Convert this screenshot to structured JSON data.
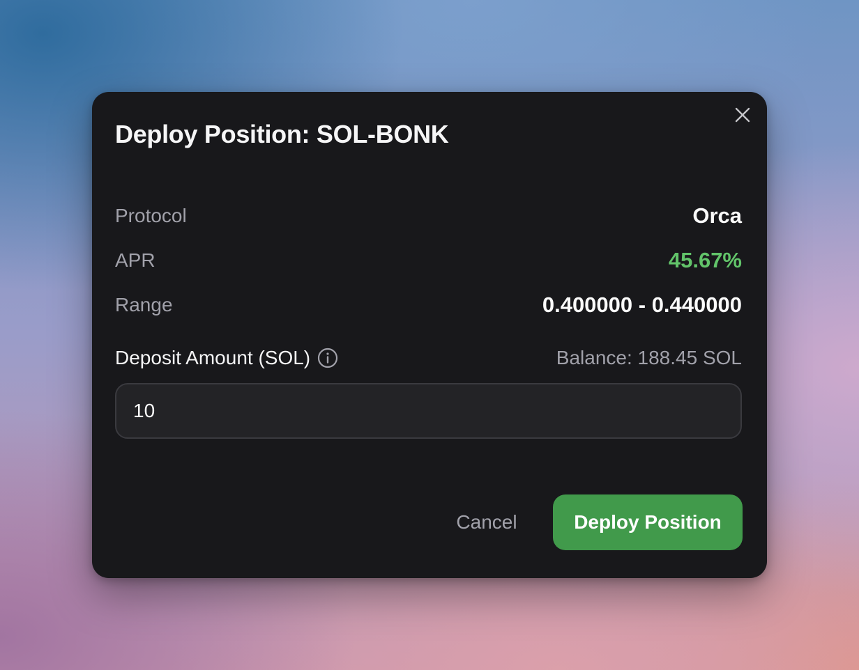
{
  "modal": {
    "title": "Deploy Position: SOL-BONK",
    "close_icon": "close-icon"
  },
  "details": {
    "protocol": {
      "label": "Protocol",
      "value": "Orca"
    },
    "apr": {
      "label": "APR",
      "value": "45.67%",
      "color": "#62c46a"
    },
    "range": {
      "label": "Range",
      "value": "0.400000 - 0.440000"
    }
  },
  "deposit": {
    "label": "Deposit Amount (SOL)",
    "info_icon": "info-circle-icon",
    "balance": "Balance: 188.45 SOL",
    "value": "10"
  },
  "actions": {
    "cancel_label": "Cancel",
    "deploy_label": "Deploy Position",
    "deploy_color": "#419a4b"
  }
}
